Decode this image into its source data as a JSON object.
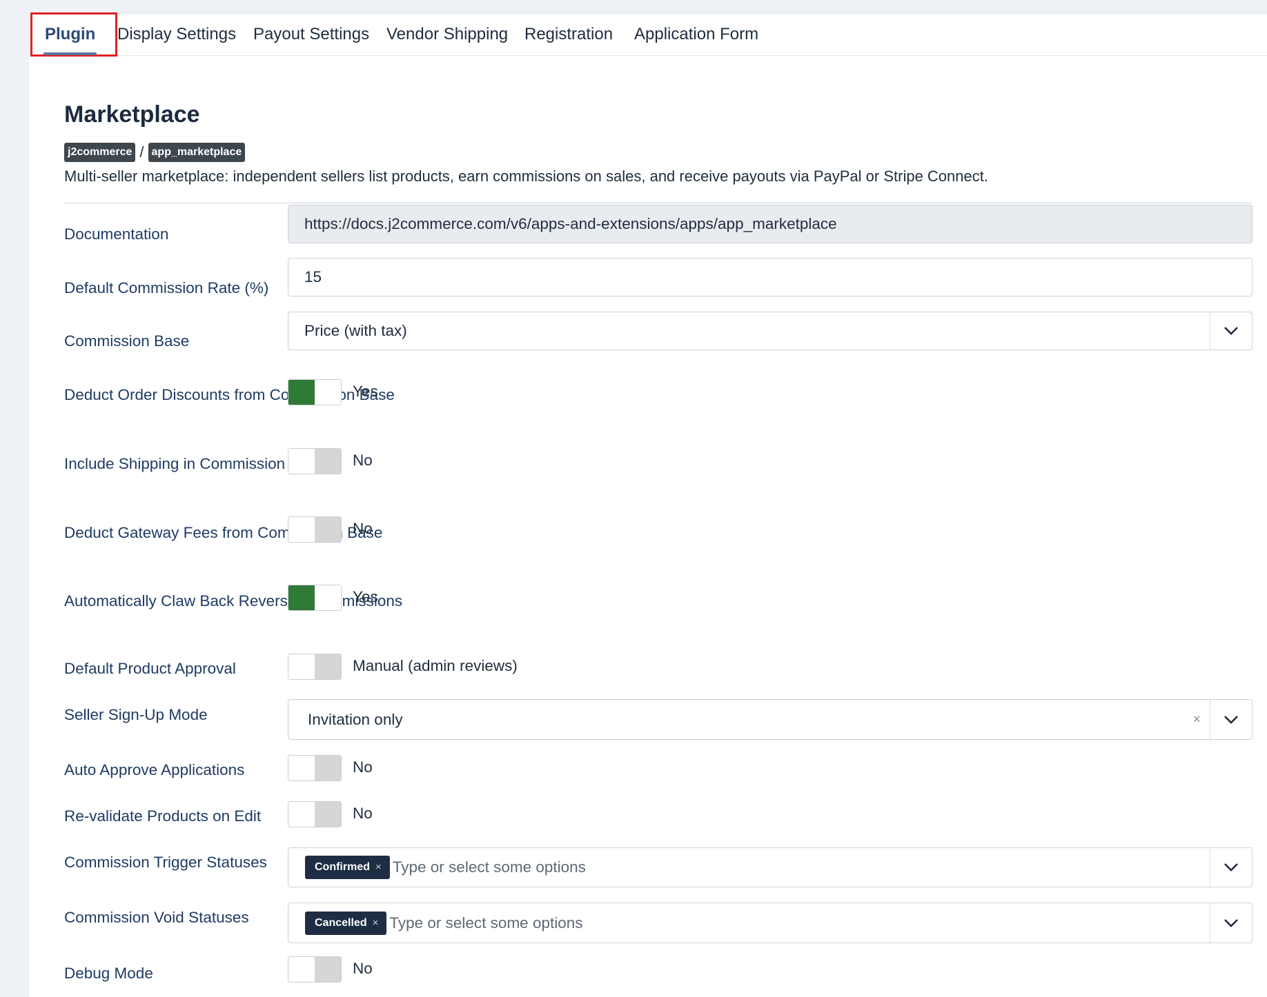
{
  "tabs": [
    {
      "label": "Plugin",
      "active": true
    },
    {
      "label": "Display Settings"
    },
    {
      "label": "Payout Settings"
    },
    {
      "label": "Vendor Shipping"
    },
    {
      "label": "Registration"
    },
    {
      "label": "Application Form"
    }
  ],
  "header": {
    "title": "Marketplace",
    "badges": [
      "j2commerce",
      "app_marketplace"
    ],
    "separator": "/",
    "description": "Multi-seller marketplace: independent sellers list products, earn commissions on sales, and receive payouts via PayPal or Stripe Connect."
  },
  "form": {
    "documentation": {
      "label": "Documentation",
      "value": "https://docs.j2commerce.com/v6/apps-and-extensions/apps/app_marketplace"
    },
    "commission_rate": {
      "label": "Default Commission Rate (%)",
      "value": "15"
    },
    "commission_base": {
      "label": "Commission Base",
      "value": "Price (with tax)"
    },
    "deduct_discounts": {
      "label": "Deduct Order Discounts from Commission Base",
      "state": "on",
      "text": "Yes"
    },
    "include_shipping": {
      "label": "Include Shipping in Commission Base",
      "state": "off",
      "text": "No"
    },
    "deduct_gateway_fees": {
      "label": "Deduct Gateway Fees from Commission Base",
      "state": "off",
      "text": "No"
    },
    "claw_back": {
      "label": "Automatically Claw Back Reversed Commissions",
      "state": "on",
      "text": "Yes"
    },
    "product_approval": {
      "label": "Default Product Approval",
      "state": "off",
      "text": "Manual (admin reviews)"
    },
    "signup_mode": {
      "label": "Seller Sign-Up Mode",
      "value": "Invitation only",
      "clear": "×"
    },
    "auto_approve": {
      "label": "Auto Approve Applications",
      "state": "off",
      "text": "No"
    },
    "revalidate": {
      "label": "Re-validate Products on Edit",
      "state": "off",
      "text": "No"
    },
    "trigger_statuses": {
      "label": "Commission Trigger Statuses",
      "chips": [
        "Confirmed"
      ],
      "placeholder": "Type or select some options"
    },
    "void_statuses": {
      "label": "Commission Void Statuses",
      "chips": [
        "Cancelled"
      ],
      "placeholder": "Type or select some options"
    },
    "debug": {
      "label": "Debug Mode",
      "state": "off",
      "text": "No"
    }
  },
  "colors": {
    "toggle_on": "#2f7a37",
    "toggle_off": "#d6d6d6",
    "chip": "#1e2d43",
    "tab_highlight": "#e0211f"
  }
}
